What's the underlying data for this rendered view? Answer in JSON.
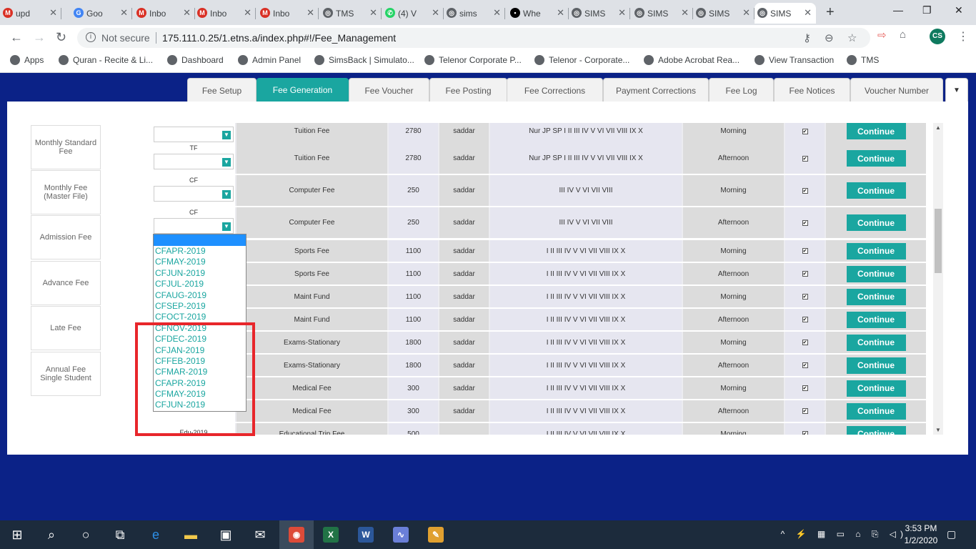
{
  "browser": {
    "tabs": [
      {
        "title": "upd",
        "icon": "gmail-icon",
        "color": "#d93025",
        "glyph": "M"
      },
      {
        "title": "Goo",
        "icon": "google-account-icon",
        "color": "#4285f4",
        "glyph": "G"
      },
      {
        "title": "Inbo",
        "icon": "gmail-icon",
        "color": "#d93025",
        "glyph": "M"
      },
      {
        "title": "Inbo",
        "icon": "gmail-icon",
        "color": "#d93025",
        "glyph": "M"
      },
      {
        "title": "Inbo",
        "icon": "gmail-icon",
        "color": "#d93025",
        "glyph": "M"
      },
      {
        "title": "TMS",
        "icon": "globe-icon",
        "color": "#5f6368",
        "glyph": "◎"
      },
      {
        "title": "(4) V",
        "icon": "whatsapp-icon",
        "color": "#25d366",
        "glyph": "✆"
      },
      {
        "title": "sims",
        "icon": "globe-icon",
        "color": "#5f6368",
        "glyph": "◎"
      },
      {
        "title": "Whe",
        "icon": "video-icon",
        "color": "#000000",
        "glyph": "▪"
      },
      {
        "title": "SIMS",
        "icon": "globe-icon",
        "color": "#5f6368",
        "glyph": "◎"
      },
      {
        "title": "SIMS",
        "icon": "globe-icon",
        "color": "#5f6368",
        "glyph": "◎"
      },
      {
        "title": "SIMS",
        "icon": "globe-icon",
        "color": "#5f6368",
        "glyph": "◎"
      },
      {
        "title": "SIMS",
        "icon": "globe-icon",
        "color": "#5f6368",
        "glyph": "◎"
      }
    ],
    "new_tab": "+",
    "minimize": "—",
    "restore": "❐",
    "close": "✕",
    "back": "←",
    "forward": "→",
    "reload": "↻",
    "not_secure": "Not secure",
    "url": "175.111.0.25/1.etns.a/index.php#!/Fee_Management",
    "avatar_initials": "CS",
    "bookmarks": [
      {
        "label": "Apps",
        "icon": "apps-grid-icon"
      },
      {
        "label": "Quran - Recite & Li...",
        "icon": "quran-icon"
      },
      {
        "label": "Dashboard",
        "icon": "globe-icon"
      },
      {
        "label": "Admin Panel",
        "icon": "globe-icon"
      },
      {
        "label": "SimsBack | Simulato...",
        "icon": "globe-icon"
      },
      {
        "label": "Telenor Corporate P...",
        "icon": "telenor-icon"
      },
      {
        "label": "Telenor - Corporate...",
        "icon": "telenor-icon"
      },
      {
        "label": "Adobe Acrobat Rea...",
        "icon": "adobe-icon"
      },
      {
        "label": "View Transaction",
        "icon": "globe-icon"
      },
      {
        "label": "TMS",
        "icon": "globe-icon"
      }
    ]
  },
  "fee_tabs": [
    "Fee Setup",
    "Fee Generation",
    "Fee Voucher",
    "Fee Posting",
    "Fee Corrections",
    "Payment Corrections",
    "Fee Log",
    "Fee Notices",
    "Voucher Number"
  ],
  "fee_tabs_active": "Fee Generation",
  "sidebar": [
    "Monthly Standard Fee",
    "Monthly Fee (Master File)",
    "Admission Fee",
    "Advance Fee",
    "Late Fee",
    "Annual Fee Single Student"
  ],
  "rows": [
    {
      "code": "",
      "name": "Tuition Fee",
      "amount": "2780",
      "branch": "saddar",
      "classes": "Nur JP SP I II III IV V VI VII VIII IX X",
      "shift": "Morning",
      "action": "Continue"
    },
    {
      "code": "TF",
      "name": "Tuition Fee",
      "amount": "2780",
      "branch": "saddar",
      "classes": "Nur JP SP I II III IV V VI VII VIII IX X",
      "shift": "Afternoon",
      "action": "Continue"
    },
    {
      "code": "CF",
      "name": "Computer Fee",
      "amount": "250",
      "branch": "saddar",
      "classes": "III IV V VI VII VIII",
      "shift": "Morning",
      "action": "Continue"
    },
    {
      "code": "CF",
      "name": "Computer Fee",
      "amount": "250",
      "branch": "saddar",
      "classes": "III IV V VI VII VIII",
      "shift": "Afternoon",
      "action": "Continue"
    },
    {
      "code": "",
      "name": "Sports Fee",
      "amount": "1100",
      "branch": "saddar",
      "classes": "I II III IV V VI VII VIII IX X",
      "shift": "Morning",
      "action": "Continue"
    },
    {
      "code": "",
      "name": "Sports Fee",
      "amount": "1100",
      "branch": "saddar",
      "classes": "I II III IV V VI VII VIII IX X",
      "shift": "Afternoon",
      "action": "Continue"
    },
    {
      "code": "",
      "name": "Maint Fund",
      "amount": "1100",
      "branch": "saddar",
      "classes": "I II III IV V VI VII VIII IX X",
      "shift": "Morning",
      "action": "Continue"
    },
    {
      "code": "",
      "name": "Maint Fund",
      "amount": "1100",
      "branch": "saddar",
      "classes": "I II III IV V VI VII VIII IX X",
      "shift": "Afternoon",
      "action": "Continue"
    },
    {
      "code": "",
      "name": "Exams-Stationary",
      "amount": "1800",
      "branch": "saddar",
      "classes": "I II III IV V VI VII VIII IX X",
      "shift": "Morning",
      "action": "Continue"
    },
    {
      "code": "",
      "name": "Exams-Stationary",
      "amount": "1800",
      "branch": "saddar",
      "classes": "I II III IV V VI VII VIII IX X",
      "shift": "Afternoon",
      "action": "Continue"
    },
    {
      "code": "",
      "name": "Medical Fee",
      "amount": "300",
      "branch": "saddar",
      "classes": "I II III IV V VI VII VIII IX X",
      "shift": "Morning",
      "action": "Continue"
    },
    {
      "code": "",
      "name": "Medical Fee",
      "amount": "300",
      "branch": "saddar",
      "classes": "I II III IV V VI VII VIII IX X",
      "shift": "Afternoon",
      "action": "Continue"
    },
    {
      "code": "Edu-2019",
      "name": "Educational Trip Fee",
      "amount": "500",
      "branch": "",
      "classes": "I II III IV V VI VII VIII IX X",
      "shift": "Morning",
      "action": "Continue"
    }
  ],
  "dropdown_options": [
    "CFAPR-2019",
    "CFMAY-2019",
    "CFJUN-2019",
    "CFJUL-2019",
    "CFAUG-2019",
    "CFSEP-2019",
    "CFOCT-2019",
    "CFNOV-2019",
    "CFDEC-2019",
    "CFJAN-2019",
    "CFFEB-2019",
    "CFMAR-2019",
    "CFAPR-2019",
    "CFMAY-2019",
    "CFJUN-2019"
  ],
  "taskbar": {
    "time": "3:53 PM",
    "date": "1/2/2020",
    "notifications": "9",
    "apps": [
      {
        "name": "chrome-app",
        "color": "#dd4b39",
        "glyph": "◉"
      },
      {
        "name": "excel-app",
        "color": "#217346",
        "glyph": "X"
      },
      {
        "name": "word-app",
        "color": "#2b579a",
        "glyph": "W"
      },
      {
        "name": "dolphin-app",
        "color": "#6a7fd8",
        "glyph": "∿"
      },
      {
        "name": "paint-app",
        "color": "#e0a030",
        "glyph": "✎"
      }
    ]
  },
  "colors": {
    "accent": "#1aa6a0",
    "page_bg": "#0b2287",
    "highlight": "#e8262b"
  }
}
